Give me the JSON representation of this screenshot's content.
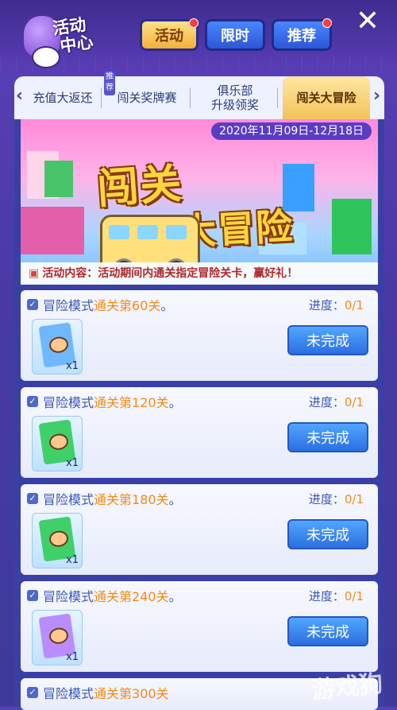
{
  "header": {
    "logo_line1": "活动",
    "logo_line2": "中心",
    "close_label": "✕",
    "tabs": [
      {
        "label": "活动",
        "active": true
      },
      {
        "label": "限时",
        "active": false
      },
      {
        "label": "推荐",
        "active": false
      }
    ]
  },
  "subtabs": {
    "left_arrow": "‹",
    "right_arrow": "›",
    "recommend_badge": "推荐",
    "items": [
      {
        "label": "充值大返还"
      },
      {
        "label": "闯关奖牌赛"
      },
      {
        "label": "俱乐部\n升级领奖"
      },
      {
        "label": "闯关大冒险",
        "active": true
      }
    ]
  },
  "banner": {
    "date_range": "2020年11月09日-12月18日",
    "title_line1": "闯关",
    "title_line2": "大冒险",
    "description": "活动内容：活动期间内通关指定冒险关卡，赢好礼！"
  },
  "tasks": [
    {
      "prefix": "冒险模式",
      "highlight": "通关第60关",
      "suffix": "。",
      "progress_label": "进度：",
      "progress": "0/1",
      "reward_count": "x1",
      "reward_color": "#6fb8ff",
      "button": "未完成"
    },
    {
      "prefix": "冒险模式",
      "highlight": "通关第120关",
      "suffix": "。",
      "progress_label": "进度：",
      "progress": "0/1",
      "reward_count": "x1",
      "reward_color": "#3fd06a",
      "button": "未完成"
    },
    {
      "prefix": "冒险模式",
      "highlight": "通关第180关",
      "suffix": "。",
      "progress_label": "进度：",
      "progress": "0/1",
      "reward_count": "x1",
      "reward_color": "#3fd06a",
      "button": "未完成"
    },
    {
      "prefix": "冒险模式",
      "highlight": "通关第240关",
      "suffix": "。",
      "progress_label": "进度：",
      "progress": "0/1",
      "reward_count": "x1",
      "reward_color": "#b98cff",
      "button": "未完成"
    }
  ],
  "peek_task": {
    "prefix": "冒险模式",
    "highlight": "通关第300关"
  },
  "watermark": "游戏狗"
}
